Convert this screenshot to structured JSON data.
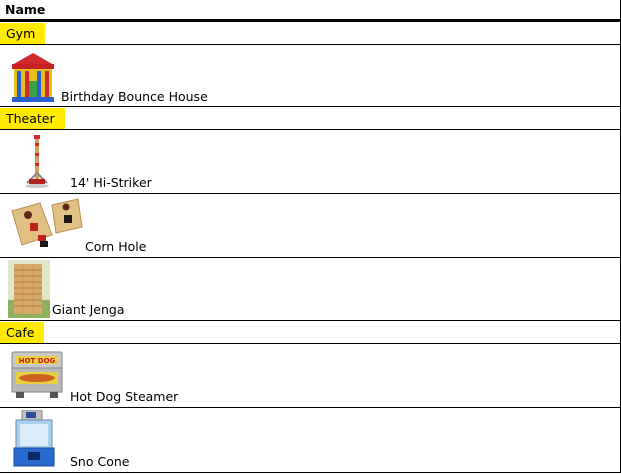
{
  "table": {
    "header": "Name",
    "categories": [
      {
        "name": "Gym",
        "items": [
          {
            "name": "Birthday Bounce House",
            "icon": "bounce-house-icon"
          }
        ]
      },
      {
        "name": "Theater",
        "items": [
          {
            "name": "14' Hi-Striker",
            "icon": "hi-striker-icon"
          },
          {
            "name": "Corn Hole",
            "icon": "corn-hole-icon"
          },
          {
            "name": "Giant Jenga",
            "icon": "giant-jenga-icon"
          }
        ]
      },
      {
        "name": "Cafe",
        "items": [
          {
            "name": "Hot Dog Steamer",
            "icon": "hot-dog-steamer-icon"
          },
          {
            "name": "Sno Cone",
            "icon": "sno-cone-machine-icon"
          }
        ]
      }
    ]
  },
  "colors": {
    "category_highlight": "#ffea00",
    "rule": "#000000"
  }
}
